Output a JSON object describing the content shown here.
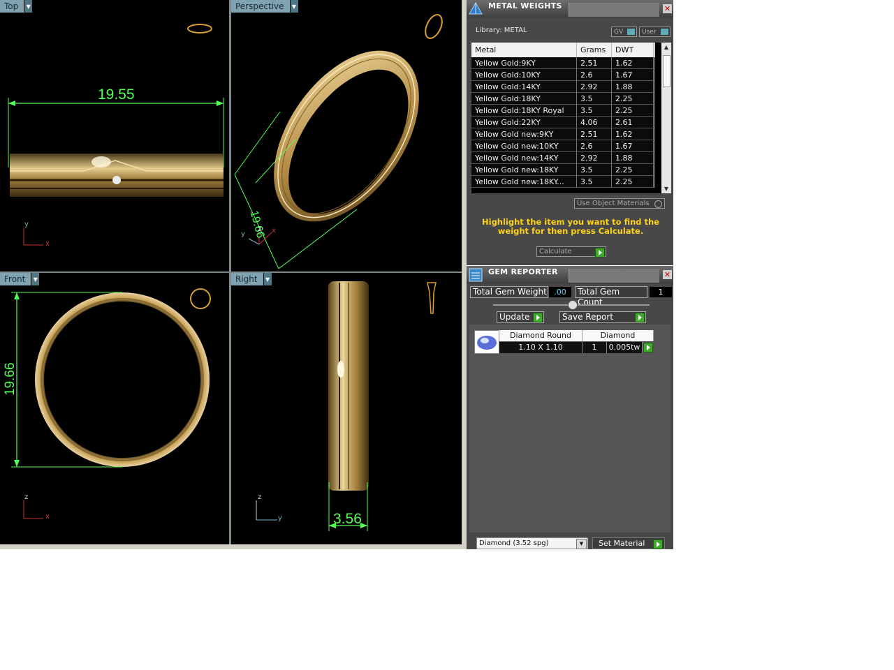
{
  "viewports": {
    "top": {
      "tab_label": "Top",
      "dimension": "19.55",
      "axis_x": "x",
      "axis_y": "y"
    },
    "perspective": {
      "tab_label": "Perspective",
      "dimension": "19.66",
      "axis_x": "x",
      "axis_y": "y",
      "axis_z": "z"
    },
    "front": {
      "tab_label": "Front",
      "dimension": "19.66",
      "axis_x": "x",
      "axis_z": "z"
    },
    "right": {
      "tab_label": "Right",
      "dimension": "3.56",
      "axis_y": "y",
      "axis_z": "z"
    }
  },
  "metal_weights": {
    "title": "METAL WEIGHTS",
    "library_label": "Library: METAL",
    "gv_label": "GV",
    "user_label": "User",
    "columns": [
      "Metal",
      "Grams",
      "DWT"
    ],
    "rows": [
      {
        "metal": "Yellow Gold:9KY",
        "grams": "2.51",
        "dwt": "1.62"
      },
      {
        "metal": "Yellow Gold:10KY",
        "grams": "2.6",
        "dwt": "1.67"
      },
      {
        "metal": "Yellow Gold:14KY",
        "grams": "2.92",
        "dwt": "1.88"
      },
      {
        "metal": "Yellow Gold:18KY",
        "grams": "3.5",
        "dwt": "2.25"
      },
      {
        "metal": "Yellow Gold:18KY Royal",
        "grams": "3.5",
        "dwt": "2.25"
      },
      {
        "metal": "Yellow Gold:22KY",
        "grams": "4.06",
        "dwt": "2.61"
      },
      {
        "metal": "Yellow Gold new:9KY",
        "grams": "2.51",
        "dwt": "1.62"
      },
      {
        "metal": "Yellow Gold new:10KY",
        "grams": "2.6",
        "dwt": "1.67"
      },
      {
        "metal": "Yellow Gold new:14KY",
        "grams": "2.92",
        "dwt": "1.88"
      },
      {
        "metal": "Yellow Gold new:18KY",
        "grams": "3.5",
        "dwt": "2.25"
      },
      {
        "metal": "Yellow Gold new:18KY...",
        "grams": "3.5",
        "dwt": "2.25"
      }
    ],
    "use_object_materials": "Use Object Materials",
    "hint": "Highlight the item you want to find the weight for then press Calculate.",
    "calculate_label": "Calculate"
  },
  "gem_reporter": {
    "title": "GEM REPORTER",
    "total_weight_label": "Total Gem Weight",
    "total_weight_value": ".00",
    "total_count_label": "Total Gem Count",
    "total_count_value": "1",
    "update_label": "Update",
    "save_report_label": "Save Report",
    "gem": {
      "cut": "Diamond Round",
      "material": "Diamond",
      "size": "1.10 X 1.10",
      "count": "1",
      "weight": "0.005tw"
    },
    "material_select": "Diamond     (3.52 spg)",
    "set_material_label": "Set Material"
  },
  "colors": {
    "dimension": "#55ff55",
    "viewport_tab": "#7fa3b0",
    "hint": "#ffd21a",
    "gold": "#c9a45a"
  }
}
